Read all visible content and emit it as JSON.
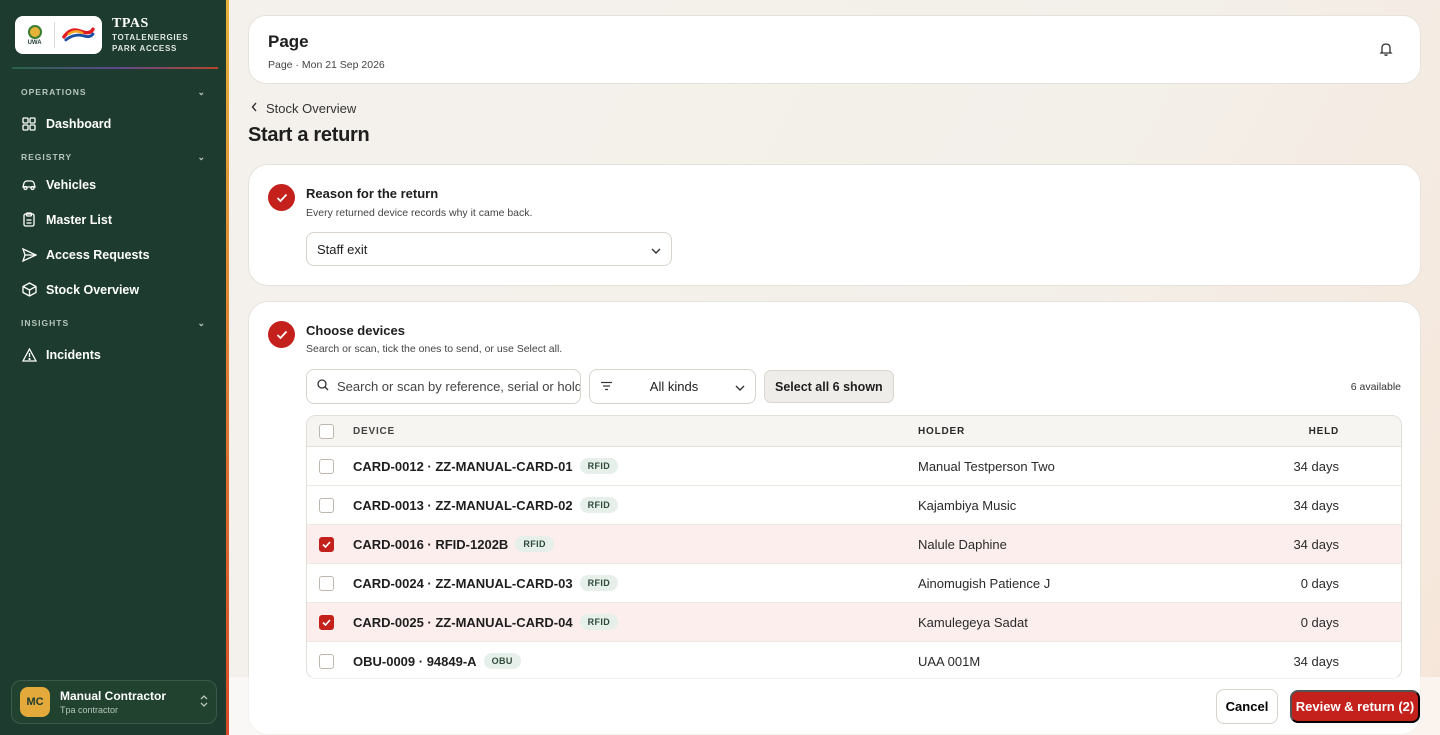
{
  "brand": {
    "title": "TPAS",
    "subtitle_line1": "TOTALENERGIES",
    "subtitle_line2": "PARK ACCESS",
    "uwa_label": "UWA"
  },
  "sidebar": {
    "sections": [
      {
        "label": "OPERATIONS",
        "items": [
          {
            "label": "Dashboard",
            "icon": "grid-icon"
          }
        ]
      },
      {
        "label": "REGISTRY",
        "items": [
          {
            "label": "Vehicles",
            "icon": "car-icon"
          },
          {
            "label": "Master List",
            "icon": "clipboard-icon"
          },
          {
            "label": "Access Requests",
            "icon": "send-icon"
          },
          {
            "label": "Stock Overview",
            "icon": "box-icon"
          }
        ]
      },
      {
        "label": "INSIGHTS",
        "items": [
          {
            "label": "Incidents",
            "icon": "warning-icon"
          }
        ]
      }
    ],
    "user": {
      "initials": "MC",
      "name": "Manual Contractor",
      "role": "Tpa contractor"
    }
  },
  "topbar": {
    "title": "Page",
    "subtitle": "Page · Mon 21 Sep 2026"
  },
  "breadcrumb": {
    "label": "Stock Overview"
  },
  "page_title": "Start a return",
  "reason": {
    "title": "Reason for the return",
    "subtitle": "Every returned device records why it came back.",
    "selected": "Staff exit"
  },
  "devices": {
    "title": "Choose devices",
    "subtitle": "Search or scan, tick the ones to send, or use Select all.",
    "search_placeholder": "Search or scan by reference, serial or holder",
    "kind_filter": "All kinds",
    "select_all_label": "Select all 6 shown",
    "available_label": "6 available",
    "columns": {
      "device": "DEVICE",
      "holder": "HOLDER",
      "held": "HELD"
    },
    "rows": [
      {
        "device": "CARD-0012 · ZZ-MANUAL-CARD-01",
        "tag": "RFID",
        "holder": "Manual Testperson Two",
        "held": "34 days",
        "checked": false
      },
      {
        "device": "CARD-0013 · ZZ-MANUAL-CARD-02",
        "tag": "RFID",
        "holder": "Kajambiya Music",
        "held": "34 days",
        "checked": false
      },
      {
        "device": "CARD-0016 · RFID-1202B",
        "tag": "RFID",
        "holder": "Nalule Daphine",
        "held": "34 days",
        "checked": true
      },
      {
        "device": "CARD-0024 · ZZ-MANUAL-CARD-03",
        "tag": "RFID",
        "holder": "Ainomugish Patience J",
        "held": "0 days",
        "checked": false
      },
      {
        "device": "CARD-0025 · ZZ-MANUAL-CARD-04",
        "tag": "RFID",
        "holder": "Kamulegeya Sadat",
        "held": "0 days",
        "checked": true
      },
      {
        "device": "OBU-0009 · 94849-A",
        "tag": "OBU",
        "holder": "UAA 001M",
        "held": "34 days",
        "checked": false
      }
    ]
  },
  "footer": {
    "cancel_label": "Cancel",
    "review_label": "Review & return (2)"
  },
  "colors": {
    "sidebar": "#1d3b2e",
    "accent": "#c4201c",
    "avatar": "#e3a93b"
  }
}
